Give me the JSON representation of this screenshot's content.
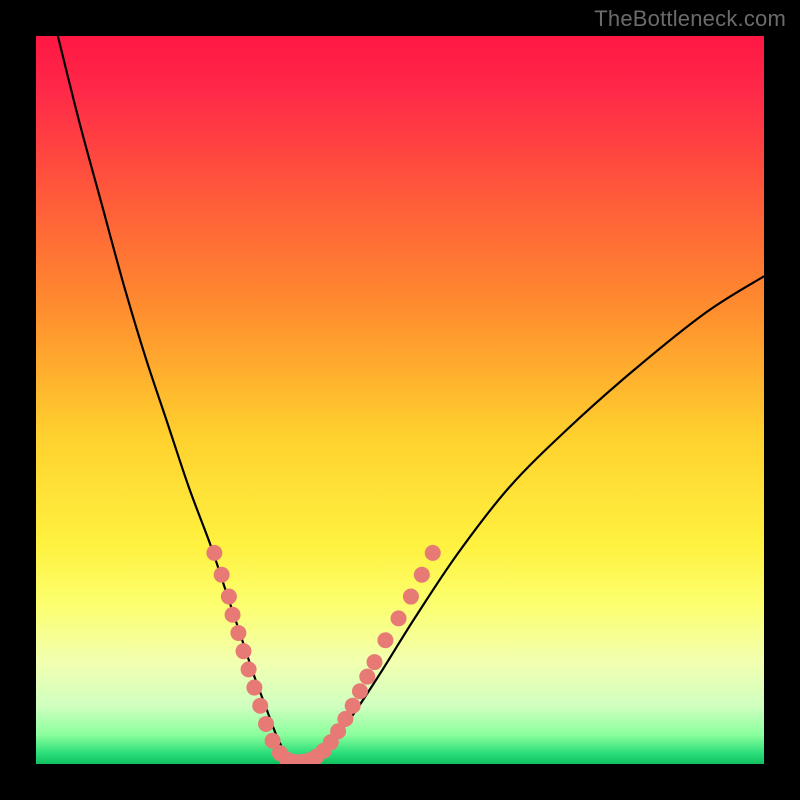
{
  "watermark": "TheBottleneck.com",
  "colors": {
    "background": "#000000",
    "gradient_stops": [
      {
        "offset": 0.0,
        "color": "#ff1744"
      },
      {
        "offset": 0.08,
        "color": "#ff2a48"
      },
      {
        "offset": 0.22,
        "color": "#ff5a3a"
      },
      {
        "offset": 0.38,
        "color": "#ff8f2e"
      },
      {
        "offset": 0.55,
        "color": "#ffd12e"
      },
      {
        "offset": 0.7,
        "color": "#fff240"
      },
      {
        "offset": 0.78,
        "color": "#fcff6e"
      },
      {
        "offset": 0.86,
        "color": "#f2ffb0"
      },
      {
        "offset": 0.92,
        "color": "#d0ffc0"
      },
      {
        "offset": 0.96,
        "color": "#8aff9c"
      },
      {
        "offset": 0.985,
        "color": "#2cde7a"
      },
      {
        "offset": 1.0,
        "color": "#10c060"
      }
    ],
    "curve": "#000000",
    "marker": "#e77a74"
  },
  "chart_data": {
    "type": "line",
    "title": "",
    "xlabel": "",
    "ylabel": "",
    "xlim": [
      0,
      100
    ],
    "ylim": [
      0,
      100
    ],
    "grid": false,
    "legend": false,
    "annotations": [],
    "series": [
      {
        "name": "bottleneck-curve",
        "x": [
          3,
          6,
          9,
          12,
          15,
          18,
          21,
          24,
          26,
          28,
          30,
          31.5,
          33,
          34.5,
          36,
          38,
          40,
          43,
          47,
          52,
          58,
          65,
          73,
          82,
          92,
          100
        ],
        "y": [
          100,
          88,
          77,
          66,
          56,
          47,
          38,
          30,
          24,
          18,
          12,
          8,
          4,
          1,
          0,
          0.5,
          2.5,
          6,
          12,
          20,
          29,
          38,
          46,
          54,
          62,
          67
        ]
      }
    ],
    "markers": {
      "name": "highlight-points",
      "points": [
        {
          "x": 24.5,
          "y": 29
        },
        {
          "x": 25.5,
          "y": 26
        },
        {
          "x": 26.5,
          "y": 23
        },
        {
          "x": 27.0,
          "y": 20.5
        },
        {
          "x": 27.8,
          "y": 18
        },
        {
          "x": 28.5,
          "y": 15.5
        },
        {
          "x": 29.2,
          "y": 13
        },
        {
          "x": 30.0,
          "y": 10.5
        },
        {
          "x": 30.8,
          "y": 8
        },
        {
          "x": 31.6,
          "y": 5.5
        },
        {
          "x": 32.5,
          "y": 3.2
        },
        {
          "x": 33.5,
          "y": 1.5
        },
        {
          "x": 34.5,
          "y": 0.6
        },
        {
          "x": 35.5,
          "y": 0.3
        },
        {
          "x": 36.5,
          "y": 0.3
        },
        {
          "x": 37.5,
          "y": 0.5
        },
        {
          "x": 38.5,
          "y": 1.0
        },
        {
          "x": 39.5,
          "y": 1.8
        },
        {
          "x": 40.5,
          "y": 3.0
        },
        {
          "x": 41.5,
          "y": 4.5
        },
        {
          "x": 42.5,
          "y": 6.2
        },
        {
          "x": 43.5,
          "y": 8.0
        },
        {
          "x": 44.5,
          "y": 10.0
        },
        {
          "x": 45.5,
          "y": 12.0
        },
        {
          "x": 46.5,
          "y": 14.0
        },
        {
          "x": 48.0,
          "y": 17.0
        },
        {
          "x": 49.8,
          "y": 20.0
        },
        {
          "x": 51.5,
          "y": 23.0
        },
        {
          "x": 53.0,
          "y": 26.0
        },
        {
          "x": 54.5,
          "y": 29.0
        }
      ]
    }
  }
}
